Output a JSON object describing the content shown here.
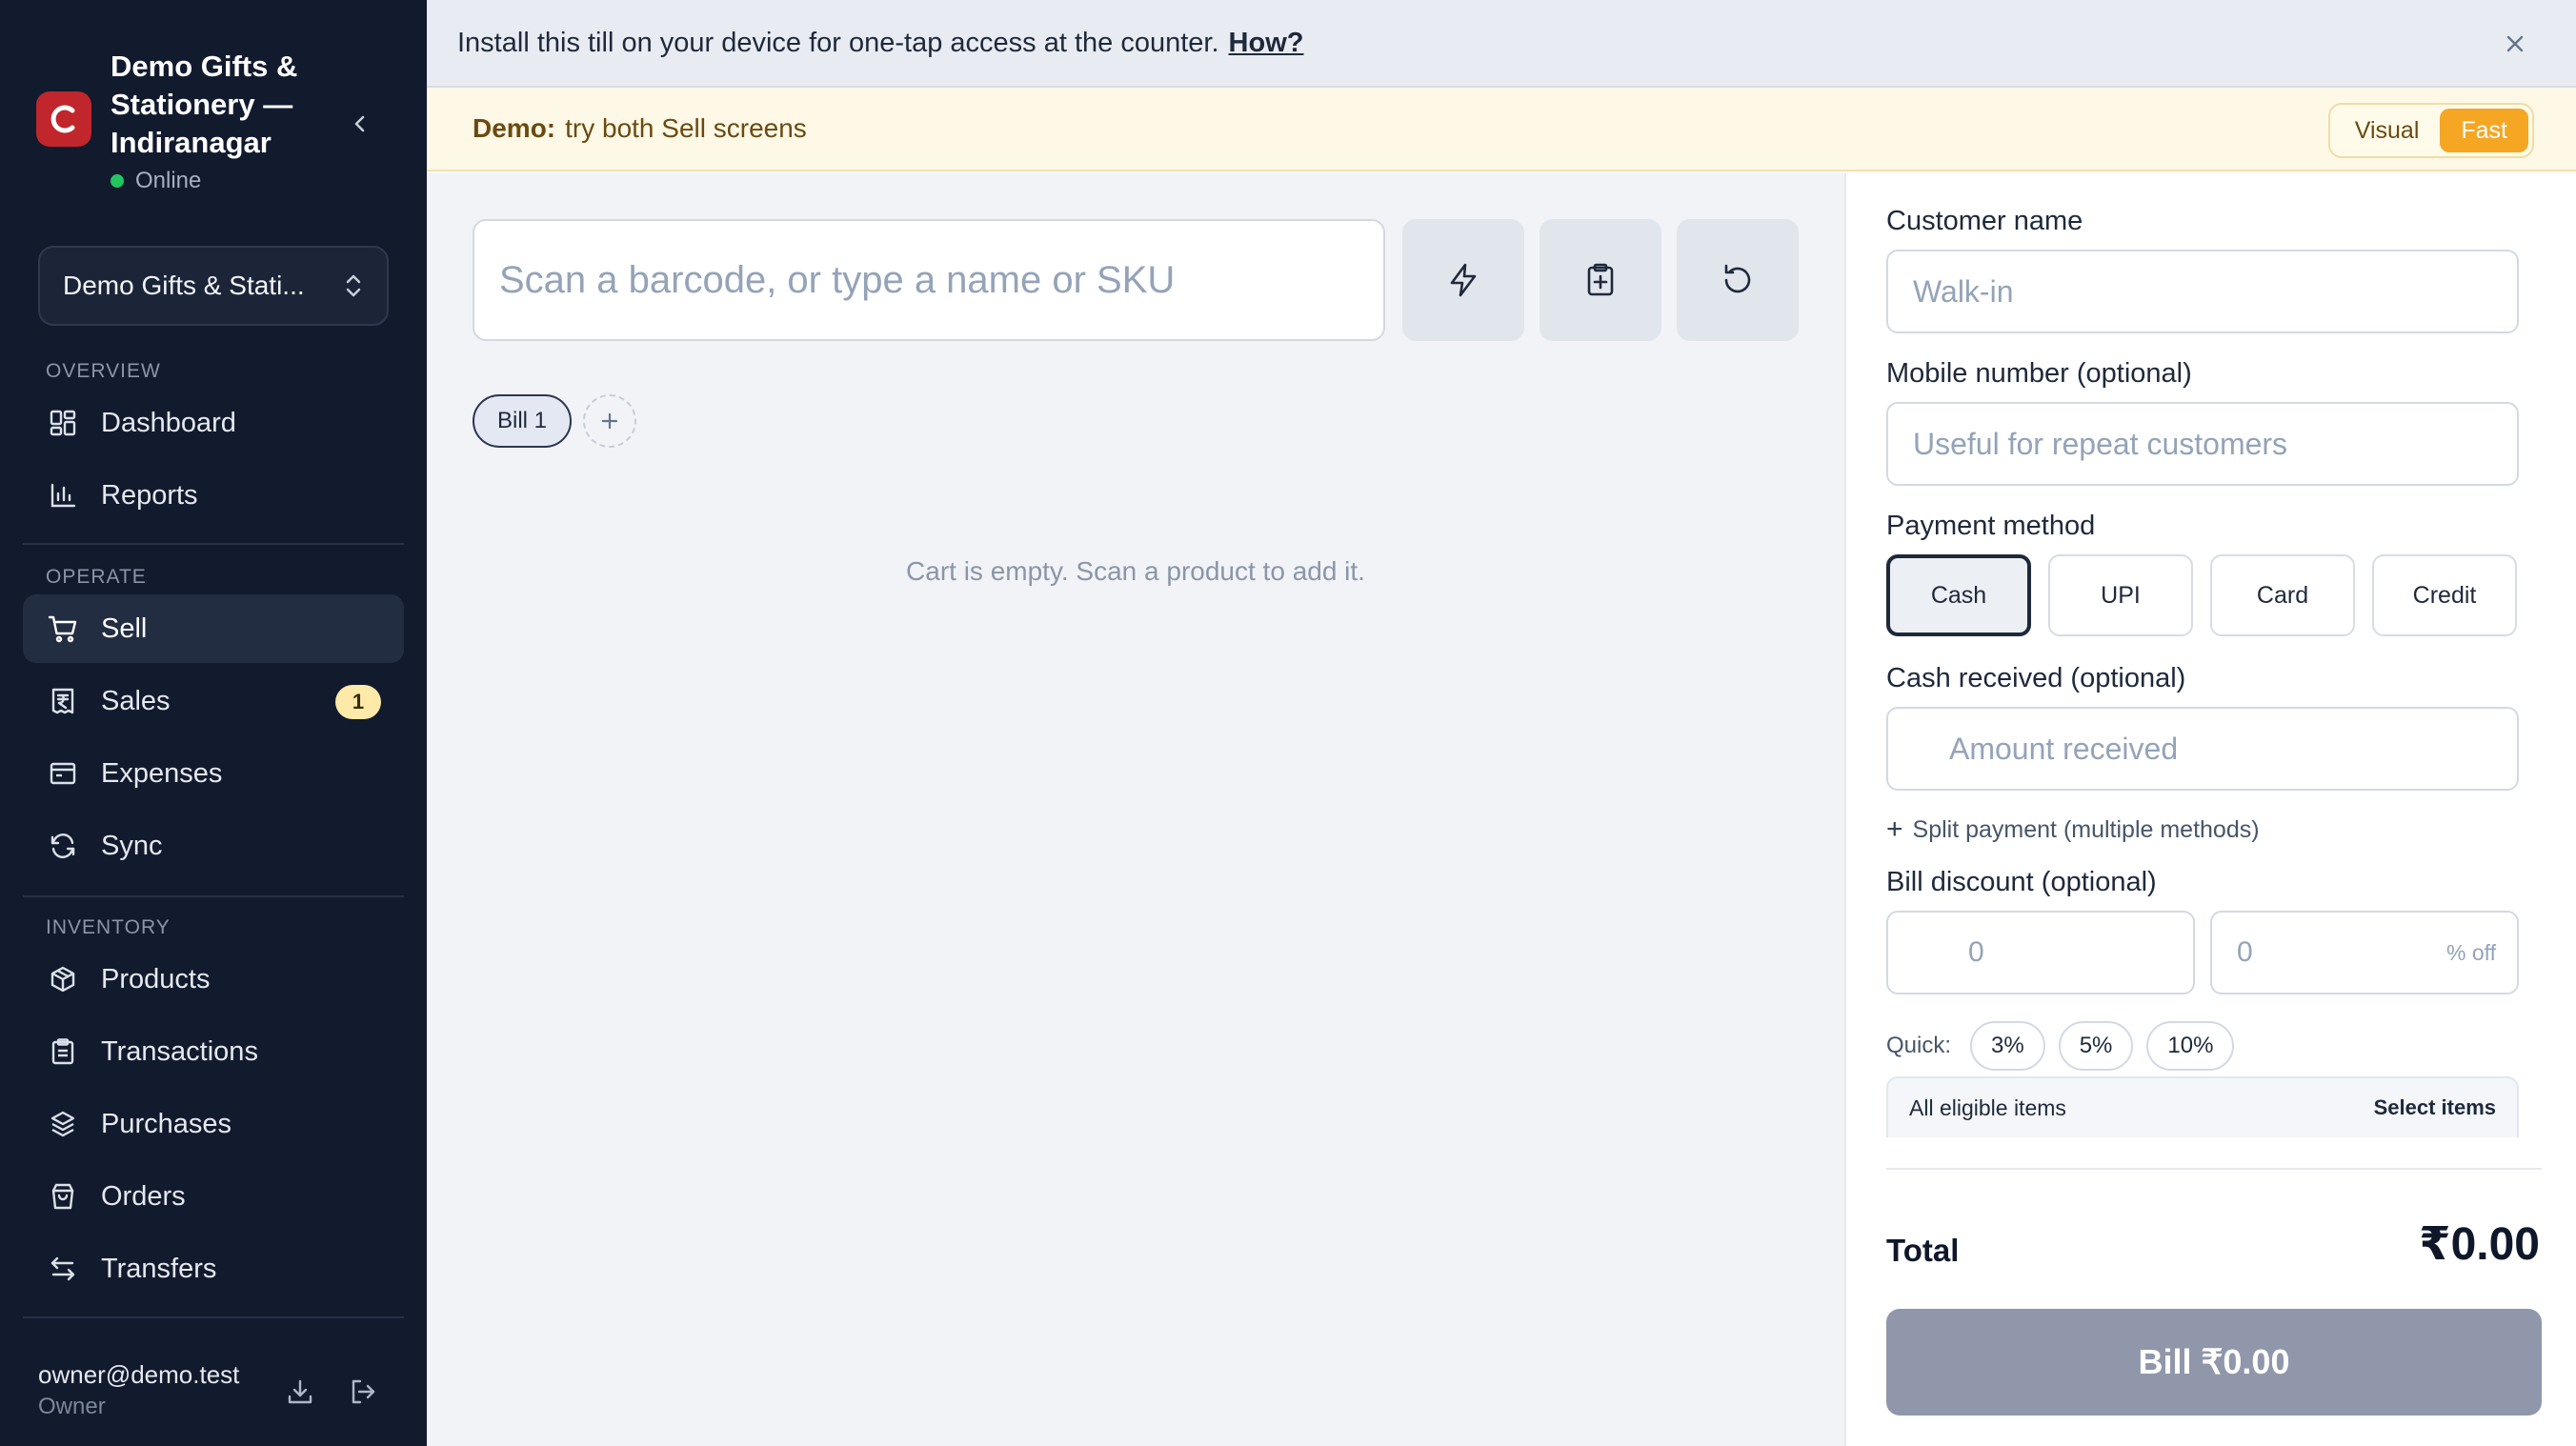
{
  "sidebar": {
    "brand_name": "Demo Gifts & Stationery — Indiranagar",
    "logo_letter": "C",
    "status": "Online",
    "store_select": "Demo Gifts & Stati...",
    "sections": {
      "overview": "OVERVIEW",
      "operate": "OPERATE",
      "inventory": "INVENTORY"
    },
    "items": [
      {
        "label": "Dashboard",
        "icon": "dashboard-icon"
      },
      {
        "label": "Reports",
        "icon": "bar-chart-icon"
      },
      {
        "label": "Sell",
        "icon": "cart-icon",
        "active": true
      },
      {
        "label": "Sales",
        "icon": "receipt-icon",
        "badge": "1"
      },
      {
        "label": "Expenses",
        "icon": "wallet-icon"
      },
      {
        "label": "Sync",
        "icon": "sync-icon"
      },
      {
        "label": "Products",
        "icon": "box-icon"
      },
      {
        "label": "Transactions",
        "icon": "clipboard-icon"
      },
      {
        "label": "Purchases",
        "icon": "package-icon"
      },
      {
        "label": "Orders",
        "icon": "bag-icon"
      },
      {
        "label": "Transfers",
        "icon": "transfer-icon"
      }
    ],
    "user": {
      "email": "owner@demo.test",
      "role": "Owner"
    }
  },
  "install_banner": {
    "text": "Install this till on your device for one-tap access at the counter.",
    "link": "How?"
  },
  "demo_banner": {
    "bold": "Demo:",
    "text": "try both Sell screens",
    "modes": [
      "Visual",
      "Fast"
    ],
    "active_mode": "Fast"
  },
  "main": {
    "search_placeholder": "Scan a barcode, or type a name or SKU",
    "bill_tab": "Bill 1",
    "empty_message": "Cart is empty. Scan a product to add it."
  },
  "checkout": {
    "customer_label": "Customer name",
    "customer_placeholder": "Walk-in",
    "mobile_label": "Mobile number (optional)",
    "mobile_placeholder": "Useful for repeat customers",
    "payment_label": "Payment method",
    "payment_methods": [
      "Cash",
      "UPI",
      "Card",
      "Credit"
    ],
    "selected_payment": "Cash",
    "cash_label": "Cash received (optional)",
    "cash_placeholder": "Amount received",
    "split_link": "Split payment (multiple methods)",
    "discount_label": "Bill discount (optional)",
    "discount_amount": "0",
    "discount_percent": "0",
    "discount_percent_suffix": "% off",
    "quick_label": "Quick:",
    "quick_options": [
      "3%",
      "5%",
      "10%"
    ],
    "scope_all": "All eligible items",
    "scope_select": "Select items",
    "total_label": "Total",
    "total_value": "₹0.00",
    "bill_button": "Bill ₹0.00"
  },
  "colors": {
    "sidebar_bg": "#121a2e",
    "logo": "#c0262b",
    "accent_fast": "#f5a623",
    "online": "#22c55e",
    "bill_button": "#9097ab"
  }
}
